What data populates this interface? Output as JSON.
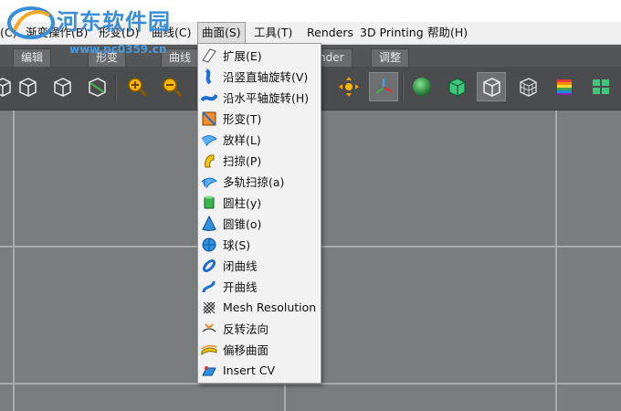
{
  "titlebar": {
    "watermark_text": "河东软件园",
    "watermark_url": "www.pc0359.cn"
  },
  "menubar": {
    "items": [
      {
        "label": "(C)"
      },
      {
        "label": "渐变操作(B)"
      },
      {
        "label": "形变(D)"
      },
      {
        "label": "曲线(C)"
      },
      {
        "label": "曲面(S)"
      },
      {
        "label": "工具(T)"
      },
      {
        "label": "Renders"
      },
      {
        "label": "3D Printing"
      },
      {
        "label": "帮助(H)"
      }
    ]
  },
  "tabs": [
    "编辑",
    "形变",
    "曲线",
    "nder",
    "调整"
  ],
  "toolbar": {
    "icons": [
      "cube-front-icon",
      "cube-wire-icon",
      "cube-select-icon",
      "zoom-in-icon",
      "zoom-out-icon",
      "orbit-icon",
      "move-icon",
      "axis-icon",
      "sphere-icon",
      "cube-solid-icon",
      "cube-outline-icon",
      "cube-mesh-icon",
      "cube-colored-icon",
      "four-view-icon"
    ]
  },
  "surface_menu": {
    "items": [
      {
        "label": "扩展(E)",
        "icon": "extend-icon"
      },
      {
        "label": "沿竖直轴旋转(V)",
        "icon": "revolve-vertical-icon"
      },
      {
        "label": "沿水平轴旋转(H)",
        "icon": "revolve-horizontal-icon"
      },
      {
        "label": "形变(T)",
        "icon": "deform-icon"
      },
      {
        "label": "放样(L)",
        "icon": "loft-icon"
      },
      {
        "label": "扫掠(P)",
        "icon": "sweep-icon"
      },
      {
        "label": "多轨扫掠(a)",
        "icon": "multi-sweep-icon"
      },
      {
        "label": "圆柱(y)",
        "icon": "cylinder-icon"
      },
      {
        "label": "圆锥(o)",
        "icon": "cone-icon"
      },
      {
        "label": "球(S)",
        "icon": "sphere-icon"
      },
      {
        "label": "闭曲线",
        "icon": "closed-curve-icon"
      },
      {
        "label": "开曲线",
        "icon": "open-curve-icon"
      },
      {
        "label": "Mesh Resolution",
        "icon": "mesh-resolution-icon"
      },
      {
        "label": "反转法向",
        "icon": "flip-normal-icon"
      },
      {
        "label": "偏移曲面",
        "icon": "offset-surface-icon"
      },
      {
        "label": "Insert CV",
        "icon": "insert-cv-icon"
      }
    ]
  },
  "colors": {
    "accent_blue": "#2f7fd0",
    "menu_bg": "#f2f2f2",
    "viewport_bg": "#7a7d7e"
  }
}
